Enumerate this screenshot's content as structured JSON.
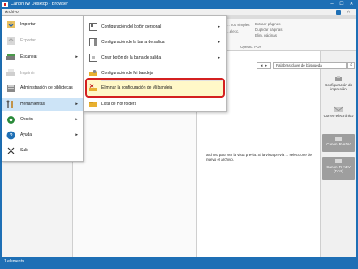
{
  "window": {
    "title": "Canon iW Desktop - Browser",
    "help_icon": "help-icon",
    "minimize_glyph": "–",
    "maximize_glyph": "☐",
    "close_glyph": "✕"
  },
  "menubar": {
    "archivo": "Archivo"
  },
  "ribbon": {
    "col1": [
      "... vos simples",
      "...elecc."
    ],
    "col2": [
      "Extraer páginas",
      "Duplicar páginas",
      "Elim. páginas"
    ],
    "group_label": "Operac. PDF"
  },
  "search": {
    "placeholder": "Palabras clave de búsqueda",
    "nav_label": "◄ ►"
  },
  "file_menu": {
    "items": [
      {
        "label": "Importar",
        "icon": "import-icon",
        "arrow": "",
        "disabled": false,
        "active": false
      },
      {
        "label": "Exportar",
        "icon": "export-icon",
        "arrow": "",
        "disabled": true,
        "active": false
      },
      {
        "label": "Escanear",
        "icon": "scanner-icon",
        "arrow": "►",
        "disabled": false,
        "active": false
      },
      {
        "label": "Imprimir",
        "icon": "printer-icon",
        "arrow": "",
        "disabled": true,
        "active": false
      },
      {
        "label": "Administración de bibliotecas",
        "icon": "library-admin-icon",
        "arrow": "",
        "disabled": false,
        "active": false
      },
      {
        "label": "Herramientas",
        "icon": "tools-icon",
        "arrow": "►",
        "disabled": false,
        "active": true
      },
      {
        "label": "Opción",
        "icon": "option-icon",
        "arrow": "►",
        "disabled": false,
        "active": false
      },
      {
        "label": "Ayuda",
        "icon": "help-circle-icon",
        "arrow": "►",
        "disabled": false,
        "active": false
      },
      {
        "label": "Salir",
        "icon": "close-x-icon",
        "arrow": "",
        "disabled": false,
        "active": false
      }
    ]
  },
  "sub_menu": {
    "items": [
      {
        "label": "Configuración del botón personal",
        "icon": "personal-button-config-icon",
        "arrow": "►"
      },
      {
        "label": "Configuración de la barra de salida",
        "icon": "output-bar-config-icon",
        "arrow": "►"
      },
      {
        "label": "Crear botón de la barra de salida",
        "icon": "create-output-button-icon",
        "arrow": "►"
      },
      {
        "label": "Configuración de Mi bandeja",
        "icon": "my-tray-config-icon",
        "arrow": ""
      },
      {
        "label": "Eliminar la configuración de Mi bandeja",
        "icon": "delete-my-tray-config-icon",
        "arrow": ""
      },
      {
        "label": "Lista de Hot folders",
        "icon": "hot-folders-icon",
        "arrow": ""
      }
    ]
  },
  "right_panel": {
    "buttons": [
      {
        "label": "Configuración de impresión",
        "icon": "print-settings-icon",
        "gray": false
      },
      {
        "label": "Correo electrónico",
        "icon": "email-icon",
        "gray": false
      },
      {
        "label": "Canon iR-ADV",
        "icon": "canon-printer-icon",
        "gray": true
      },
      {
        "label": "Canon iR-ADV (FAX)",
        "icon": "canon-fax-icon",
        "gray": true
      }
    ]
  },
  "preview": {
    "message": "archivo para ver la vista previa. Si la vista previa ... seleccione de nuevo el archivo."
  },
  "status": {
    "text": "1 elements"
  },
  "colors": {
    "titlebar": "#1e6fb5",
    "highlight_border": "#d42020",
    "menu_active": "#cde4f7"
  }
}
